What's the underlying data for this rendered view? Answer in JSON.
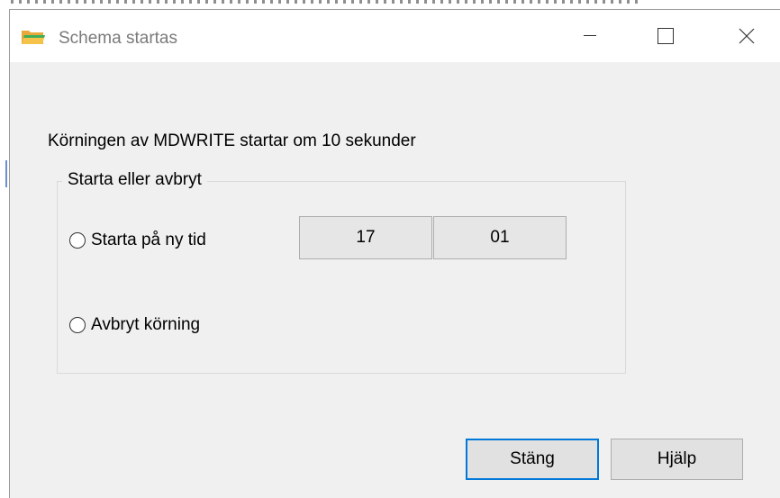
{
  "window": {
    "title": "Schema startas",
    "icon": "folder-icon"
  },
  "message": "Körningen av MDWRITE startar om 10 sekunder",
  "group": {
    "legend": "Starta eller avbryt",
    "options": [
      {
        "label": "Starta på ny tid",
        "selected": false
      },
      {
        "label": "Avbryt körning",
        "selected": false
      }
    ],
    "time": {
      "hour": "17",
      "minute": "01"
    }
  },
  "buttons": {
    "close": "Stäng",
    "help": "Hjälp"
  },
  "colors": {
    "focus_border": "#0078d7",
    "dialog_bg": "#f0f0f0",
    "folder_yellow": "#f5c24a",
    "folder_green": "#3fae5a"
  }
}
